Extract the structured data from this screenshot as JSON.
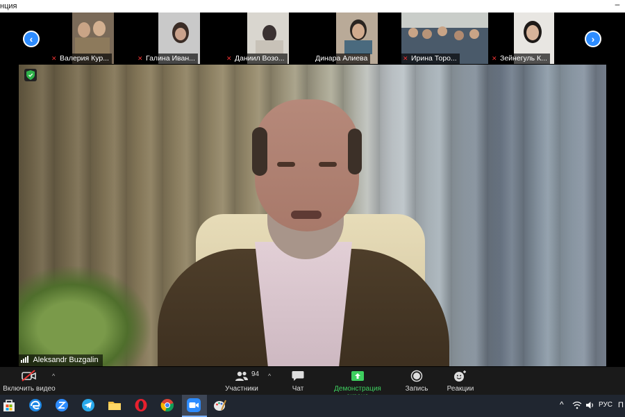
{
  "window": {
    "title": "нция"
  },
  "strip": {
    "prev_icon": "chevron-left-icon",
    "next_icon": "chevron-right-icon",
    "participants": [
      {
        "name": "Валерия Кур...",
        "muted": true
      },
      {
        "name": "Галина Иван...",
        "muted": true
      },
      {
        "name": "Даниил Возо...",
        "muted": true
      },
      {
        "name": "Динара Алиева",
        "muted": false
      },
      {
        "name": "Ирина Торо...",
        "muted": true
      },
      {
        "name": "Зейнегуль К...",
        "muted": true
      }
    ]
  },
  "main_video": {
    "speaker_name": "Aleksandr Buzgalin"
  },
  "toolbar": {
    "video_label": "Включить видео",
    "participants_label": "Участники",
    "participants_count": "94",
    "chat_label": "Чат",
    "share_label": "Демонстрация экрана",
    "record_label": "Запись",
    "reactions_label": "Реакции"
  },
  "taskbar": {
    "language": "РУС",
    "edge_text": "П"
  },
  "colors": {
    "accent": "#2d8cff",
    "share_green": "#3ecf5f",
    "muted_red": "#e33333",
    "toolbar_bg": "#1a1a1a"
  }
}
